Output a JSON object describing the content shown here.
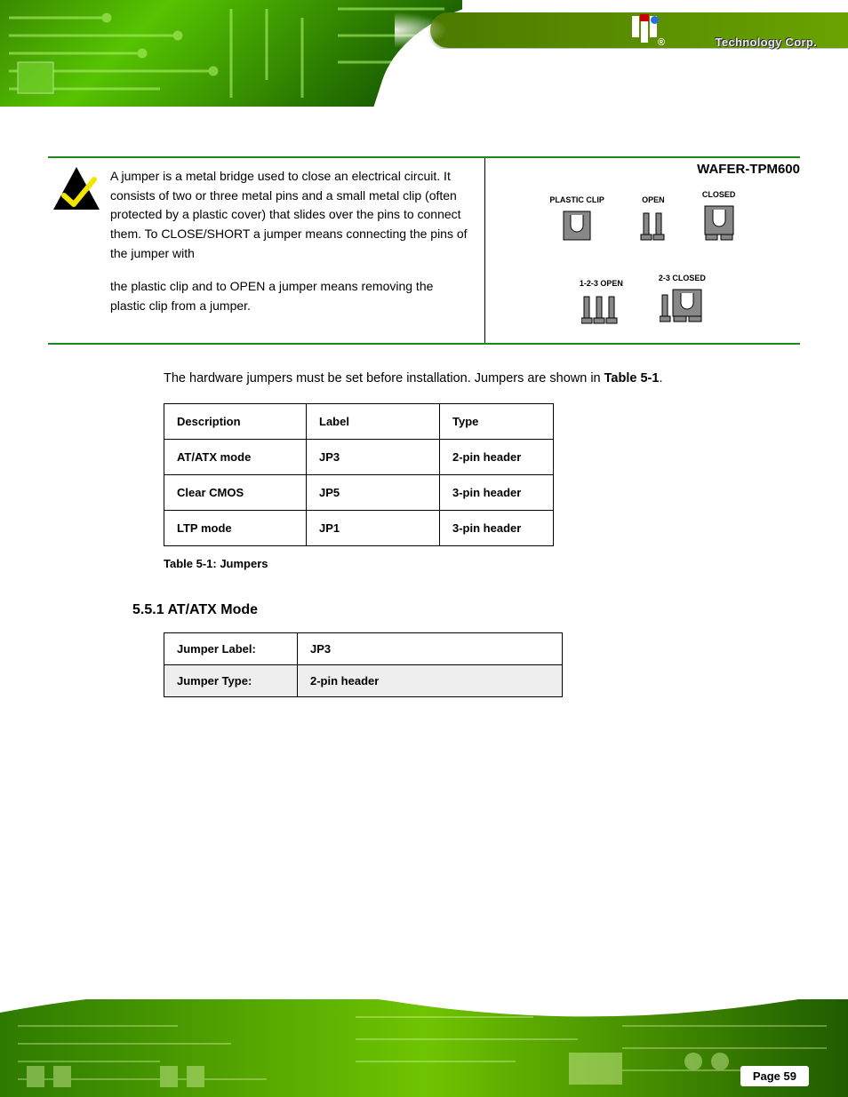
{
  "header": {
    "brand_text": "Technology Corp.",
    "reg_mark": "®"
  },
  "doc_title": "WAFER-TPM600",
  "note": {
    "para1": "A jumper is a metal bridge used to close an electrical circuit. It consists of two or three metal pins and a small metal clip (often protected by a plastic cover) that slides over the pins to connect them. To CLOSE/SHORT a jumper means connecting the pins of the jumper with",
    "para2": "the plastic clip and to OPEN a jumper means removing the plastic clip from a jumper.",
    "fig_labels": {
      "plastic_clip": "PLASTIC CLIP",
      "open": "OPEN",
      "closed": "CLOSED",
      "open123": "1-2-3 OPEN",
      "closed23": "2-3 CLOSED"
    }
  },
  "intro_para": "The hardware jumpers must be set before installation. Jumpers are shown in Table 5-1.",
  "table1": {
    "headers": [
      "Description",
      "Label",
      "Type"
    ],
    "rows": [
      [
        "AT/ATX mode",
        "JP3",
        "2-pin header"
      ],
      [
        "Clear CMOS",
        "JP5",
        "3-pin header"
      ],
      [
        "LTP mode",
        "JP1",
        "3-pin header"
      ]
    ],
    "caption": "Table 5-1: Jumpers"
  },
  "section_heading": "5.5.1 AT/ATX Mode",
  "table2": {
    "rows": [
      [
        "Jumper Label:",
        "JP3"
      ],
      [
        "Jumper Type:",
        "2-pin header"
      ]
    ]
  },
  "page_number": "Page 59"
}
